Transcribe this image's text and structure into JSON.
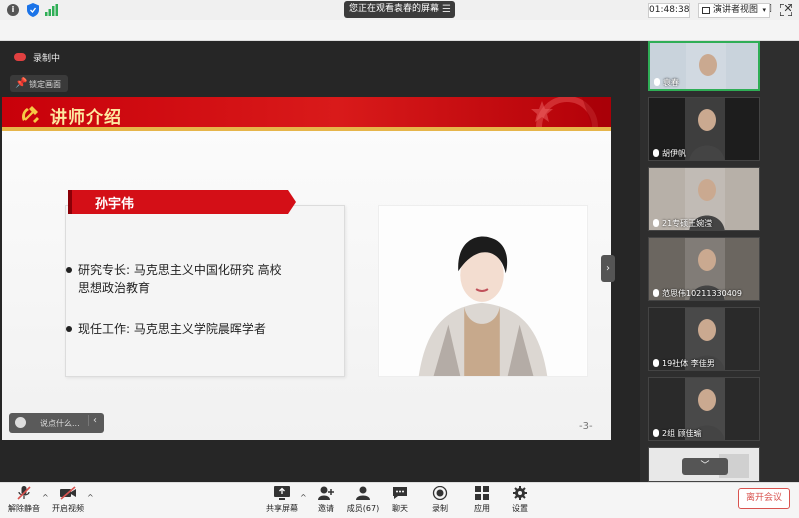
{
  "window": {
    "sharing_text": "您正在观看袁春的屏幕",
    "minimize": "—",
    "maximize": "☐",
    "close": "✕",
    "sharing_menu_icon": "menu-icon"
  },
  "infobar": {
    "timer": "01:48:38",
    "view_label": "演讲者视图",
    "view_caret": "▾",
    "info_glyph": "i"
  },
  "recording": {
    "label": "录制中",
    "lock_label": "锁定画面"
  },
  "slide": {
    "title": "讲师介绍",
    "name": "孙宇伟",
    "bullets": [
      {
        "line1": "研究专长: 马克思主义中国化研究 高校",
        "line2": "思想政治教育"
      },
      {
        "line1": "现任工作: 马克思主义学院晨晖学者",
        "line2": ""
      }
    ],
    "page": "-3-"
  },
  "chat": {
    "placeholder": "说点什么...",
    "arrow": "‹"
  },
  "collapse_glyph": "›",
  "participants": [
    {
      "name": "袁春",
      "active": true,
      "bg": "#c9d3dc"
    },
    {
      "name": "胡伊帆",
      "active": false,
      "bg": "#1d1d1d"
    },
    {
      "name": "21专硕王婉滢",
      "active": false,
      "bg": "#b7b0a8"
    },
    {
      "name": "范思伟10211330409",
      "active": false,
      "bg": "#6b6660"
    },
    {
      "name": "19社体 李佳男",
      "active": false,
      "bg": "#2a2a2a"
    },
    {
      "name": "2组 顾佳瑜",
      "active": false,
      "bg": "#2a2a2a"
    },
    {
      "name": "",
      "active": false,
      "bg": "#e8e8e8"
    }
  ],
  "scroll_glyph": "﹀",
  "toolbar": {
    "mute": "解除静音",
    "video": "开启视频",
    "share": "共享屏幕",
    "invite": "邀请",
    "members": "成员(67)",
    "chat": "聊天",
    "record": "录制",
    "apps": "应用",
    "settings": "设置",
    "leave": "离开会议",
    "caret": "^"
  },
  "colors": {
    "header_red": "#c8000a",
    "title_gold": "#fde8a0",
    "active_green": "#2fae56",
    "leave_red": "#d9534f"
  }
}
